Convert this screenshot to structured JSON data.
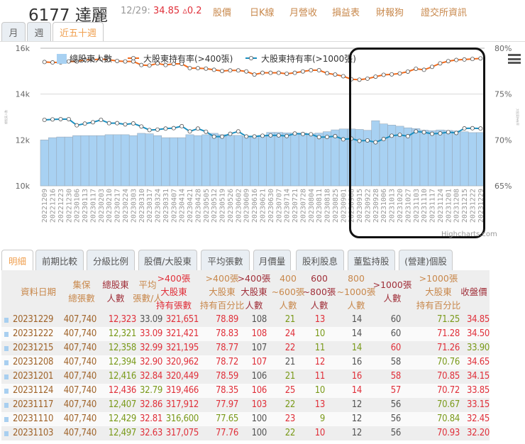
{
  "header": {
    "code_name": "6177 達麗",
    "date": "12/29:",
    "price": "34.85",
    "change": "▵0.2",
    "links": [
      "股價",
      "日K線",
      "月營收",
      "損益表",
      "財報狗",
      "證交所資訊"
    ]
  },
  "period_tabs": [
    "月",
    "週",
    "近五十週"
  ],
  "chart_tabs_active": "近五十週",
  "chart_data": {
    "type": "bar+line",
    "legend": [
      "總股東人數",
      "大股東持有率(>400張)",
      "大股東持有率(>1000張)"
    ],
    "y_left": {
      "ticks": [
        "10k",
        "12k",
        "14k",
        "16k"
      ],
      "range": [
        10000,
        16000
      ],
      "title": "總股東人數"
    },
    "y_right": {
      "ticks": [
        "65%",
        "70%",
        "75%",
        "80%"
      ],
      "range": [
        65,
        80
      ],
      "title": "大股東持有率"
    },
    "categories": [
      "20221209",
      "20221216",
      "20221223",
      "20221230",
      "20230106",
      "20230113",
      "20230117",
      "20230203",
      "20230210",
      "20230217",
      "20230224",
      "20230303",
      "20230310",
      "20230317",
      "20230324",
      "20230331",
      "20230407",
      "20230414",
      "20230421",
      "20230428",
      "20230505",
      "20230512",
      "20230519",
      "20230526",
      "20230602",
      "20230609",
      "20230616",
      "20230621",
      "20230630",
      "20230707",
      "20230714",
      "20230721",
      "20230728",
      "20230804",
      "20230811",
      "20230818",
      "20230825",
      "20230901",
      "20230908",
      "20230915",
      "20230922",
      "20230928",
      "20231006",
      "20231013",
      "20231020",
      "20231027",
      "20231103",
      "20231110",
      "20231117",
      "20231124",
      "20231201",
      "20231208",
      "20231215",
      "20231222",
      "20231229"
    ],
    "series": [
      {
        "name": "總股東人數",
        "type": "bar",
        "color": "#a8d1f2",
        "values": [
          12000,
          12100,
          12130,
          12130,
          12190,
          12190,
          12190,
          12190,
          12230,
          12230,
          12230,
          12190,
          12290,
          12270,
          12190,
          12100,
          12100,
          12100,
          12230,
          12190,
          12230,
          12290,
          12230,
          12200,
          12200,
          12150,
          12150,
          12200,
          12330,
          12330,
          12310,
          12300,
          12300,
          12270,
          12300,
          12360,
          12440,
          12480,
          12480,
          12460,
          12420,
          12840,
          12700,
          12650,
          12600,
          12530,
          12497,
          12429,
          12407,
          12436,
          12416,
          12394,
          12358,
          12321,
          12323
        ]
      },
      {
        "name": "大股東持有率(>400張)",
        "type": "line",
        "color": "#f26a1b",
        "values": [
          78.5,
          78.45,
          78.45,
          78.56,
          78.56,
          78.74,
          78.74,
          78.82,
          78.74,
          78.61,
          78.56,
          78.56,
          78.17,
          78.12,
          78.35,
          78.17,
          78.3,
          78.3,
          77.83,
          77.83,
          77.78,
          77.65,
          77.52,
          77.58,
          77.58,
          77.47,
          77.13,
          77.32,
          77.32,
          77.32,
          77.22,
          77.32,
          77.47,
          77.6,
          77.6,
          77.27,
          77.13,
          76.95,
          76.62,
          76.57,
          76.68,
          76.9,
          77.1,
          77.15,
          77.25,
          77.45,
          77.76,
          77.65,
          77.97,
          78.35,
          78.59,
          78.72,
          78.77,
          78.83,
          78.89
        ]
      },
      {
        "name": "大股東持有率(>1000張)",
        "type": "line",
        "color": "#1a8fc0",
        "values": [
          72.19,
          72.24,
          72.27,
          72.27,
          71.6,
          71.78,
          71.93,
          72.19,
          71.83,
          71.83,
          71.7,
          71.8,
          71.47,
          71.08,
          71.13,
          71.24,
          71.29,
          71.5,
          70.93,
          71.24,
          70.9,
          70.36,
          70.36,
          70.67,
          70.93,
          70.38,
          70.38,
          70.46,
          70.5,
          70.5,
          70.43,
          70.7,
          70.65,
          70.62,
          70.31,
          70.33,
          70.41,
          70.07,
          70.15,
          69.9,
          69.95,
          69.75,
          70.1,
          70.46,
          70.56,
          70.41,
          70.93,
          70.84,
          70.67,
          70.72,
          70.85,
          70.76,
          71.26,
          71.28,
          71.25
        ]
      }
    ],
    "grid": true,
    "legend_position": "top"
  },
  "credit": "Highcharts.com",
  "table_tabs": [
    "明細",
    "前期比較",
    "分級比例",
    "股價/大股東",
    "平均張數",
    "月價量",
    "股利股息",
    "董監持股",
    "(營建)個股"
  ],
  "table": {
    "headers": [
      [
        "資料日期"
      ],
      [
        "集保",
        "總張數"
      ],
      [
        "總股東",
        "人數"
      ],
      [
        "平均",
        "張數/人"
      ],
      [
        ">400張",
        "大股東",
        "持有張數"
      ],
      [
        ">400張",
        "大股東",
        "持有百分比"
      ],
      [
        ">400張",
        "大股東",
        "人數"
      ],
      [
        "400",
        "~600張",
        "人數"
      ],
      [
        "600",
        "~800張",
        "人數"
      ],
      [
        "800",
        "~1000張",
        "人數"
      ],
      [
        ">1000張",
        "人數"
      ],
      [
        ">1000張",
        "大股東",
        "持有百分比"
      ],
      [
        "收盤價"
      ]
    ],
    "rows": [
      {
        "v": [
          "20231229",
          "407,740",
          "12,323",
          "33.09",
          "321,651",
          "78.89",
          "108",
          "21",
          "13",
          "14",
          "60",
          "71.25",
          "34.85"
        ],
        "c": "bbrnrrngrnngr"
      },
      {
        "v": [
          "20231222",
          "407,740",
          "12,321",
          "33.09",
          "321,421",
          "78.83",
          "108",
          "24",
          "10",
          "14",
          "60",
          "71.28",
          "34.50"
        ],
        "c": "bbgrrrrrgnnrr"
      },
      {
        "v": [
          "20231215",
          "407,740",
          "12,358",
          "32.99",
          "321,195",
          "78.77",
          "107",
          "22",
          "11",
          "14",
          "60",
          "71.26",
          "33.90"
        ],
        "c": "bbgrrrnrggrrg"
      },
      {
        "v": [
          "20231208",
          "407,740",
          "12,394",
          "32.90",
          "320,962",
          "78.72",
          "107",
          "21",
          "12",
          "16",
          "58",
          "70.76",
          "34.65"
        ],
        "c": "bbgrrrrnrnngr"
      },
      {
        "v": [
          "20231201",
          "407,740",
          "12,416",
          "32.84",
          "320,449",
          "78.59",
          "106",
          "21",
          "11",
          "16",
          "58",
          "70.85",
          "34.15"
        ],
        "c": "bbgrrrngrrrrr"
      },
      {
        "v": [
          "20231124",
          "407,740",
          "12,436",
          "32.79",
          "319,466",
          "78.35",
          "106",
          "25",
          "10",
          "14",
          "57",
          "70.72",
          "33.85"
        ],
        "c": "bbrgrrrrgrrrr"
      },
      {
        "v": [
          "20231117",
          "407,740",
          "12,407",
          "32.86",
          "317,912",
          "77.97",
          "103",
          "22",
          "13",
          "12",
          "56",
          "70.67",
          "33.15"
        ],
        "c": "bbgrrrrgrnngr"
      },
      {
        "v": [
          "20231110",
          "407,740",
          "12,429",
          "32.81",
          "316,600",
          "77.65",
          "100",
          "23",
          "9",
          "12",
          "56",
          "70.84",
          "32.45"
        ],
        "c": "bbgrggnrgnngr"
      },
      {
        "v": [
          "20231103",
          "407,740",
          "12,497",
          "32.63",
          "317,075",
          "77.76",
          "100",
          "22",
          "10",
          "12",
          "56",
          "70.93",
          "32.20"
        ],
        "c": "bbgrrrngrnnrr"
      }
    ]
  }
}
